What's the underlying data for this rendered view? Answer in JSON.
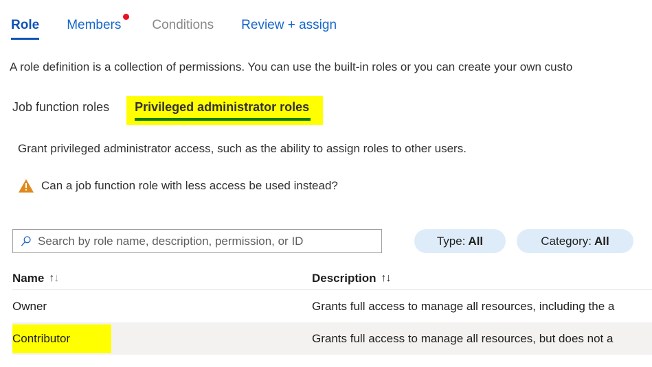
{
  "wizard": {
    "tabs": [
      {
        "label": "Role",
        "state": "active",
        "badge": false
      },
      {
        "label": "Members",
        "state": "link",
        "badge": true
      },
      {
        "label": "Conditions",
        "state": "disabled",
        "badge": false
      },
      {
        "label": "Review + assign",
        "state": "link",
        "badge": false
      }
    ]
  },
  "intro": {
    "text": "A role definition is a collection of permissions. You can use the built-in roles or you can create your own custo"
  },
  "pivots": {
    "job_function": "Job function roles",
    "privileged_admin": "Privileged administrator roles"
  },
  "subtitle": {
    "text": "Grant privileged administrator access, such as the ability to assign roles to other users."
  },
  "warning": {
    "icon": "warning-triangle-icon",
    "text": "Can a job function role with less access be used instead?"
  },
  "search": {
    "icon": "search-icon",
    "value": "",
    "placeholder": "Search by role name, description, permission, or ID"
  },
  "filters": [
    {
      "name": "Type",
      "separator": " : ",
      "value": "All"
    },
    {
      "name": "Category",
      "separator": " : ",
      "value": "All"
    }
  ],
  "table": {
    "columns": [
      {
        "label": "Name",
        "sort": "asc-inactive"
      },
      {
        "label": "Description",
        "sort": "both"
      }
    ],
    "rows": [
      {
        "name": "Owner",
        "description": "Grants full access to manage all resources, including the a",
        "selected": false,
        "highlighted": false
      },
      {
        "name": "Contributor",
        "description": "Grants full access to manage all resources, but does not a",
        "selected": true,
        "highlighted": true
      }
    ]
  },
  "colors": {
    "accent_blue": "#0f53b5",
    "link_blue": "#1566c9",
    "disabled_grey": "#8a8886",
    "badge_red": "#e81123",
    "highlight_yellow": "#ffff00",
    "underline_green": "#107c10",
    "warning_orange": "#e08a1e",
    "pill_blue": "#deecf9",
    "row_selected": "#f3f2f1"
  }
}
